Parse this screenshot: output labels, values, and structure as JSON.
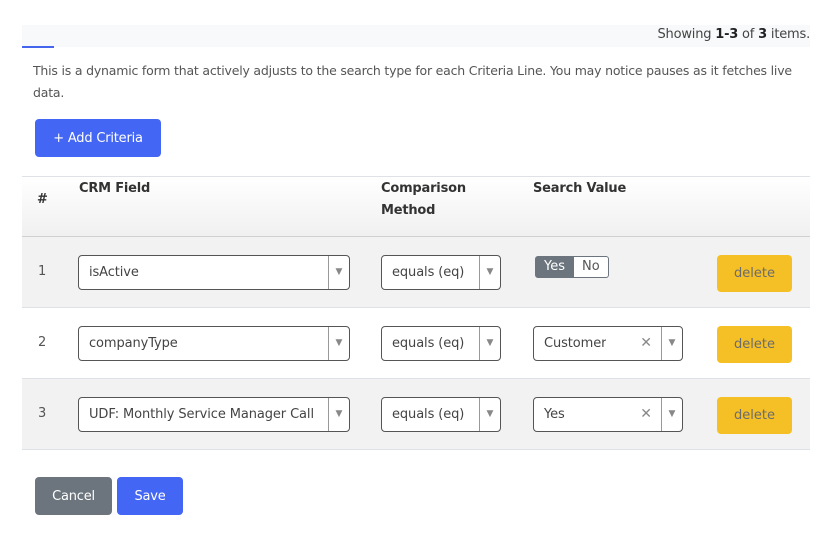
{
  "summary": {
    "prefix": "Showing",
    "range": "1-3",
    "of": "of",
    "total": "3",
    "suffix": "items."
  },
  "description": "This is a dynamic form that actively adjusts to the search type for each Criteria Line. You may notice pauses as it fetches live data.",
  "buttons": {
    "add_criteria": "+ Add Criteria",
    "cancel": "Cancel",
    "save": "Save",
    "delete": "delete"
  },
  "table": {
    "headers": {
      "num": "#",
      "field": "CRM Field",
      "method": "Comparison Method",
      "value": "Search Value"
    },
    "rows": [
      {
        "num": "1",
        "field": "isActive",
        "method": "equals (eq)",
        "value_type": "toggle",
        "toggle": {
          "yes": "Yes",
          "no": "No",
          "selected": "Yes"
        }
      },
      {
        "num": "2",
        "field": "companyType",
        "method": "equals (eq)",
        "value_type": "select",
        "value": "Customer"
      },
      {
        "num": "3",
        "field": "UDF: Monthly Service Manager Call",
        "method": "equals (eq)",
        "value_type": "select",
        "value": "Yes"
      }
    ]
  },
  "icons": {
    "dropdown": "▼",
    "clear": "✕"
  },
  "colors": {
    "primary": "#4466f5",
    "secondary": "#6c757d",
    "warning": "#f5c026"
  }
}
